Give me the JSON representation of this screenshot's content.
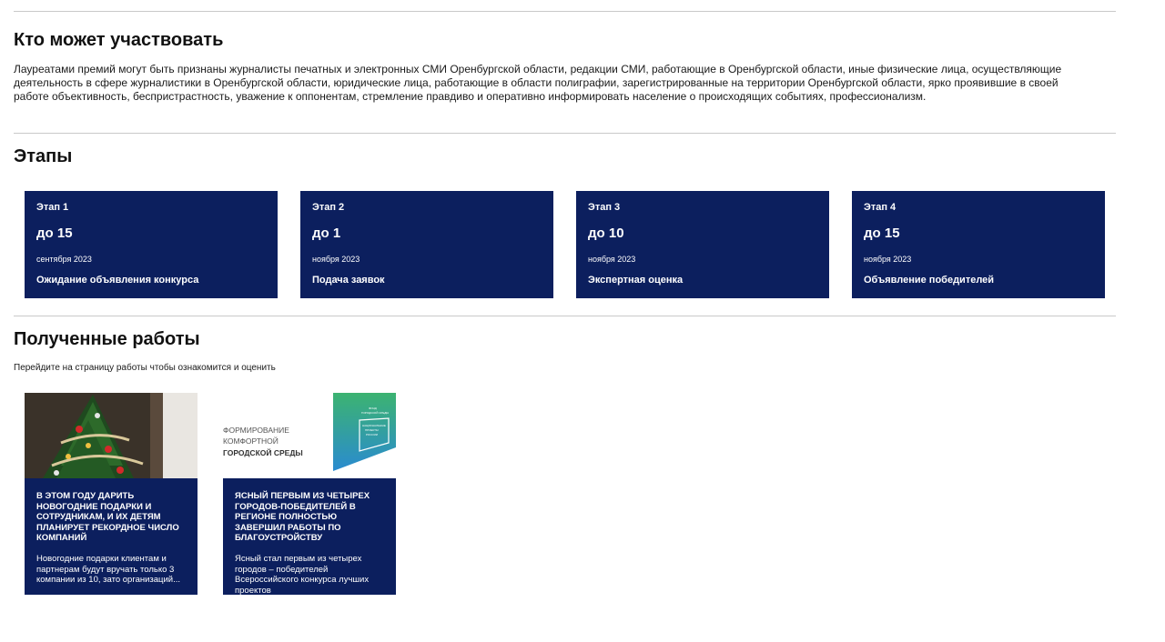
{
  "who": {
    "heading": "Кто может участвовать",
    "text": "Лауреатами премий могут быть признаны журналисты печатных и электронных СМИ Оренбургской области, редакции СМИ, работающие в Оренбургской области, иные физические лица, осуществляющие деятельность в сфере журналистики в Оренбургской области, юридические лица, работающие в области полиграфии, зарегистрированные на территории Оренбургской области, ярко проявившие в своей работе объективность, беспристрастность, уважение к оппонентам, стремление правдиво и оперативно информировать население о происходящих событиях, профессионализм."
  },
  "stages": {
    "heading": "Этапы",
    "items": [
      {
        "num": "Этап 1",
        "date": "до 15",
        "month": "сентября 2023",
        "title": "Ожидание объявления конкурса"
      },
      {
        "num": "Этап 2",
        "date": "до 1",
        "month": "ноября 2023",
        "title": "Подача заявок"
      },
      {
        "num": "Этап 3",
        "date": "до 10",
        "month": "ноября 2023",
        "title": "Экспертная оценка"
      },
      {
        "num": "Этап 4",
        "date": "до 15",
        "month": "ноября 2023",
        "title": "Объявление победителей"
      }
    ]
  },
  "works": {
    "heading": "Полученные работы",
    "note": "Перейдите на страницу работы чтобы ознакомится и оценить",
    "items": [
      {
        "title": "В этом году дарить новогодние подарки и сотрудникам, и их детям планирует рекордное число компаний",
        "desc": "Новогодние подарки клиентам и партнерам будут вручать только 3 компании из 10, зато организаций...",
        "image": "christmas-tree"
      },
      {
        "title": "Ясный первым из четырех городов-победителей в регионе полностью завершил работы по благоустройству",
        "desc": "Ясный стал первым из четырех городов – победителей Всероссийского конкурса лучших проектов",
        "image": "comfort-environment-logo",
        "logo_text": [
          "ФОРМИРОВАНИЕ",
          "КОМФОРТНОЙ",
          "ГОРОДСКОЙ СРЕДЫ"
        ],
        "badge_text": [
          "ФОНД",
          "ГОРОДСКОЙ СРЕДЫ",
          "НАЦИОНАЛЬНЫЕ",
          "ПРОЕКТЫ",
          "РОССИИ"
        ]
      }
    ]
  },
  "colors": {
    "card_bg": "#0c1f5e",
    "rule": "#c9c9c9"
  }
}
